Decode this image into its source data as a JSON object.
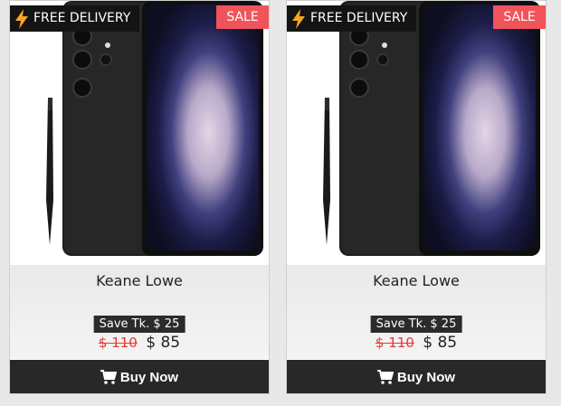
{
  "products": [
    {
      "delivery_badge": "FREE DELIVERY",
      "delivery_icon": "lightning-bolt-icon",
      "sale_badge": "SALE",
      "name": "Keane Lowe",
      "save_text": "Save Tk. $ 25",
      "old_price": "$ 110",
      "new_price": "$ 85",
      "buy_label": "Buy Now",
      "buy_icon": "cart-icon"
    },
    {
      "delivery_badge": "FREE DELIVERY",
      "delivery_icon": "lightning-bolt-icon",
      "sale_badge": "SALE",
      "name": "Keane Lowe",
      "save_text": "Save Tk. $ 25",
      "old_price": "$ 110",
      "new_price": "$ 85",
      "buy_label": "Buy Now",
      "buy_icon": "cart-icon"
    }
  ],
  "colors": {
    "sale_badge": "#f0545a",
    "dark_bar": "#282828",
    "bolt": "#f6a623",
    "old_price": "#e53935"
  }
}
